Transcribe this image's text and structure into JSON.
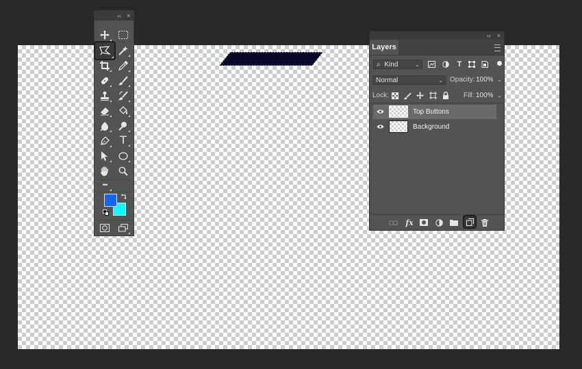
{
  "colors": {
    "foreground": "#1166ff",
    "background": "#00ffff",
    "shape_fill": "#08082a"
  },
  "toolbox": {
    "collapse_glyph": "‹‹",
    "close_glyph": "×",
    "tools": [
      {
        "name": "move-tool",
        "icon": "move-icon"
      },
      {
        "name": "marquee-tool",
        "icon": "rectangular-marquee-icon"
      },
      {
        "name": "polygonal-lasso-tool",
        "icon": "polygonal-lasso-icon",
        "selected": true
      },
      {
        "name": "magic-wand-tool",
        "icon": "magic-wand-icon"
      },
      {
        "name": "crop-tool",
        "icon": "crop-icon"
      },
      {
        "name": "eyedropper-tool",
        "icon": "eyedropper-icon"
      },
      {
        "name": "healing-brush-tool",
        "icon": "bandage-icon"
      },
      {
        "name": "brush-tool",
        "icon": "brush-icon"
      },
      {
        "name": "clone-stamp-tool",
        "icon": "stamp-icon"
      },
      {
        "name": "history-brush-tool",
        "icon": "history-brush-icon"
      },
      {
        "name": "eraser-tool",
        "icon": "eraser-icon"
      },
      {
        "name": "paint-bucket-tool",
        "icon": "paint-bucket-icon"
      },
      {
        "name": "blur-tool",
        "icon": "blur-drop-icon"
      },
      {
        "name": "dodge-tool",
        "icon": "dodge-icon"
      },
      {
        "name": "pen-tool",
        "icon": "pen-icon"
      },
      {
        "name": "type-tool",
        "icon": "type-icon",
        "glyph": "T"
      },
      {
        "name": "path-selection-tool",
        "icon": "arrow-cursor-icon"
      },
      {
        "name": "ellipse-tool",
        "icon": "ellipse-icon"
      },
      {
        "name": "hand-tool",
        "icon": "hand-icon"
      },
      {
        "name": "zoom-tool",
        "icon": "magnifier-icon"
      },
      {
        "name": "edit-toolbar",
        "icon": "ellipsis-icon",
        "glyph": "•••"
      }
    ]
  },
  "layers_panel": {
    "collapse_glyph": "‹‹",
    "close_glyph": "×",
    "tab_label": "Layers",
    "filter": {
      "value": "Kind",
      "search_glyph": "⌕"
    },
    "blend_mode": "Normal",
    "opacity_label": "Opacity:",
    "opacity_value": "100%",
    "lock_label": "Lock:",
    "fill_label": "Fill:",
    "fill_value": "100%",
    "filter_type_glyph": "T",
    "layers": [
      {
        "name": "Top Buttons",
        "selected": true,
        "visible": true
      },
      {
        "name": "Background",
        "selected": false,
        "visible": true
      }
    ],
    "fx_label": "fx"
  }
}
